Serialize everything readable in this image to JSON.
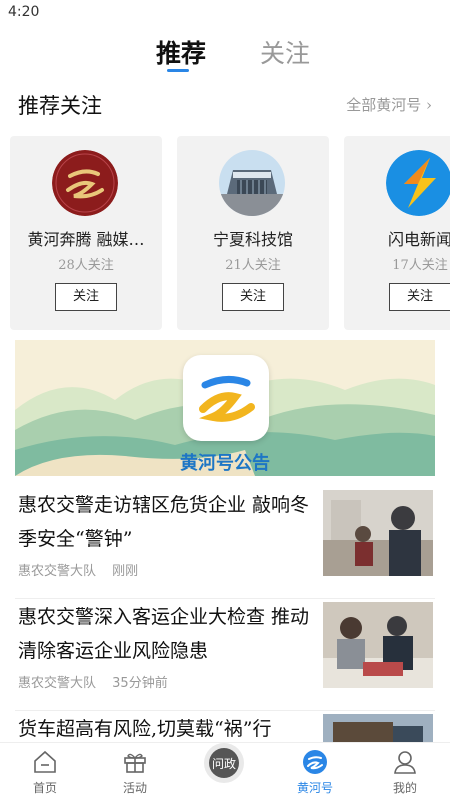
{
  "status": {
    "time": "4:20"
  },
  "tabs": [
    {
      "label": "推荐",
      "active": true
    },
    {
      "label": "关注",
      "active": false
    }
  ],
  "recommend": {
    "title": "推荐关注",
    "more": "全部黄河号 ›",
    "cards": [
      {
        "name": "黄河奔腾 融媒…",
        "count": "28人关注",
        "button": "关注",
        "avatar": "calligraphy-logo-icon"
      },
      {
        "name": "宁夏科技馆",
        "count": "21人关注",
        "button": "关注",
        "avatar": "museum-building-photo"
      },
      {
        "name": "闪电新闻",
        "count": "17人关注",
        "button": "关注",
        "avatar": "lightning-logo-icon"
      }
    ]
  },
  "banner": {
    "label": "黄河号公告"
  },
  "news": [
    {
      "headline": "惠农交警走访辖区危货企业 敲响冬季安全“警钟”",
      "source": "惠农交警大队",
      "time": "刚刚"
    },
    {
      "headline": "惠农交警深入客运企业大检查 推动清除客运企业风险隐患",
      "source": "惠农交警大队",
      "time": "35分钟前"
    },
    {
      "headline": "货车超高有风险,切莫载“祸”行",
      "source": "",
      "time": ""
    }
  ],
  "nav": [
    {
      "label": "首页",
      "icon": "home-icon",
      "active": false
    },
    {
      "label": "活动",
      "icon": "gift-icon",
      "active": false
    },
    {
      "label": "问政",
      "icon": "ask-icon",
      "active": false
    },
    {
      "label": "黄河号",
      "icon": "yellow-river-icon",
      "active": true
    },
    {
      "label": "我的",
      "icon": "profile-icon",
      "active": false
    }
  ],
  "colors": {
    "accent": "#2a86e6",
    "banner_text": "#1d76c5"
  }
}
